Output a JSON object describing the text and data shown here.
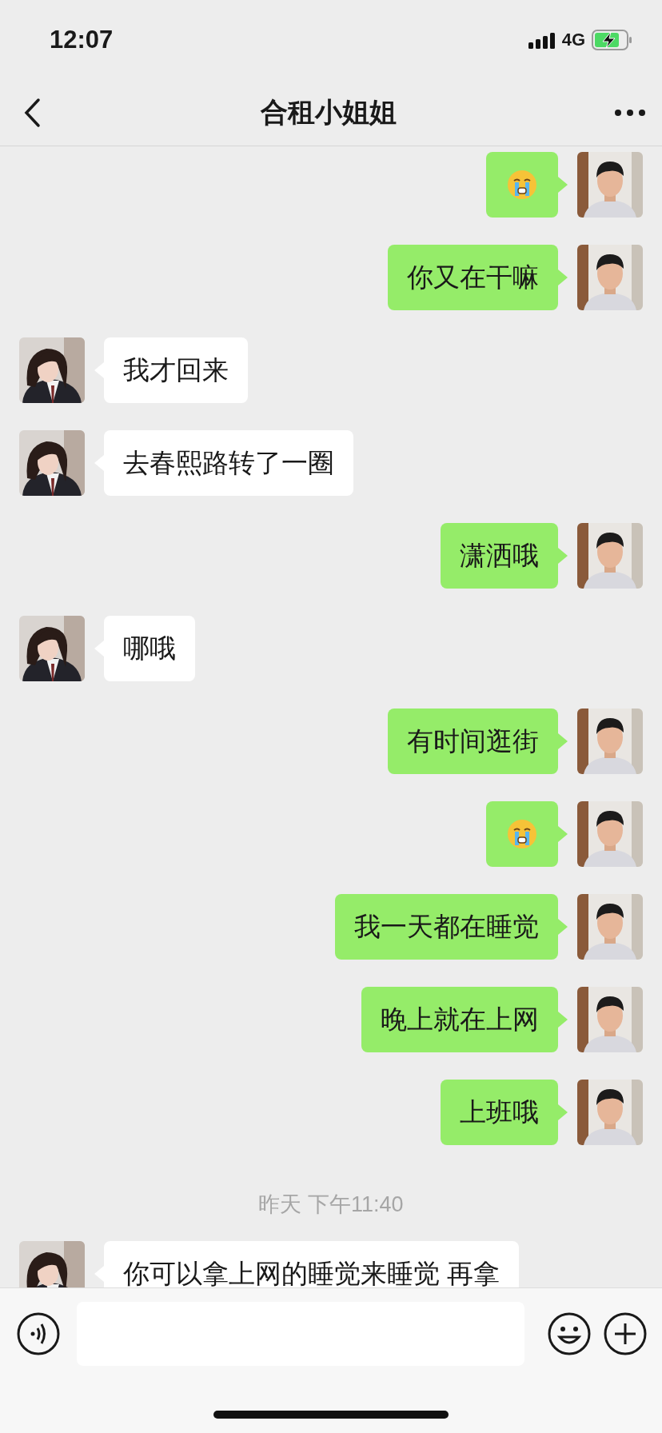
{
  "status_bar": {
    "time": "12:07",
    "network": "4G"
  },
  "nav": {
    "title": "合租小姐姐"
  },
  "messages": [
    {
      "kind": "emoji",
      "outgoing": true
    },
    {
      "kind": "text",
      "outgoing": true,
      "text": "你又在干嘛"
    },
    {
      "kind": "text",
      "outgoing": false,
      "text": "我才回来"
    },
    {
      "kind": "text",
      "outgoing": false,
      "text": "去春熙路转了一圈"
    },
    {
      "kind": "text",
      "outgoing": true,
      "text": "潇洒哦"
    },
    {
      "kind": "text",
      "outgoing": false,
      "text": "哪哦"
    },
    {
      "kind": "text",
      "outgoing": true,
      "text": "有时间逛街"
    },
    {
      "kind": "emoji",
      "outgoing": true
    },
    {
      "kind": "text",
      "outgoing": true,
      "text": "我一天都在睡觉"
    },
    {
      "kind": "text",
      "outgoing": true,
      "text": "晚上就在上网"
    },
    {
      "kind": "text",
      "outgoing": true,
      "text": "上班哦"
    },
    {
      "kind": "time",
      "text": "昨天 下午11:40"
    },
    {
      "kind": "text",
      "outgoing": false,
      "text": "你可以拿上网的睡觉来睡觉 再拿"
    }
  ]
}
